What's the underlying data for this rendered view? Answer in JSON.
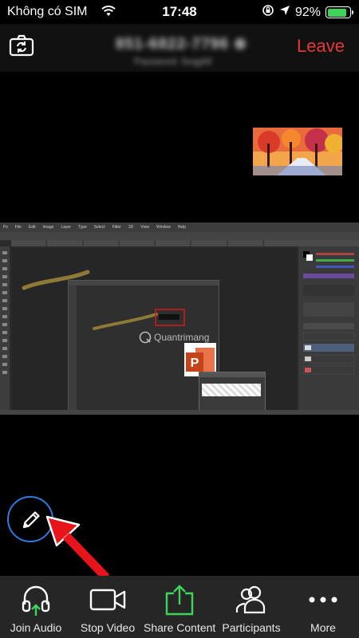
{
  "status_bar": {
    "carrier": "Không có SIM",
    "time": "17:48",
    "battery_percent": "92%",
    "battery_level": 0.92
  },
  "meeting": {
    "id_blurred": "851-6822-7796 ⊕",
    "password_blurred": "Password: 5xqgNf",
    "leave_label": "Leave"
  },
  "share_screen": {
    "watermark": "Quantrimang",
    "app_menu": [
      "Ps",
      "File",
      "Edit",
      "Image",
      "Layer",
      "Type",
      "Select",
      "Filter",
      "3D",
      "View",
      "Window",
      "Help"
    ]
  },
  "toolbar": {
    "join_audio": "Join Audio",
    "stop_video": "Stop Video",
    "share_content": "Share Content",
    "participants": "Participants",
    "more": "More"
  },
  "colors": {
    "leave": "#e53935",
    "share_icon": "#3ed45a",
    "pencil_ring": "#2d7be0",
    "annotation_arrow": "#e8141b",
    "battery": "#3ed45a"
  },
  "icons": [
    "wifi-icon",
    "lock-rotation-icon",
    "location-arrow-icon",
    "battery-icon",
    "camera-switch-icon",
    "pencil-icon",
    "headphones-icon",
    "video-camera-icon",
    "share-upload-icon",
    "participants-icon",
    "more-dots-icon"
  ]
}
